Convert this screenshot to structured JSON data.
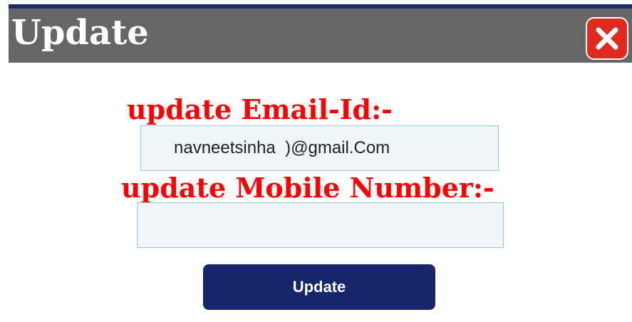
{
  "dialog": {
    "title": "Update",
    "close_icon": "close-icon",
    "accent_color": "#e02a1f"
  },
  "form": {
    "email_label": "update Email-Id:-",
    "email_value": "navneetsinha  )@gmail.Com",
    "mobile_label": "update Mobile Number:-",
    "mobile_value": "",
    "submit_label": "Update"
  },
  "colors": {
    "title_bar": "#666666",
    "label_text": "#ff0000",
    "button_bg": "#17256b"
  }
}
